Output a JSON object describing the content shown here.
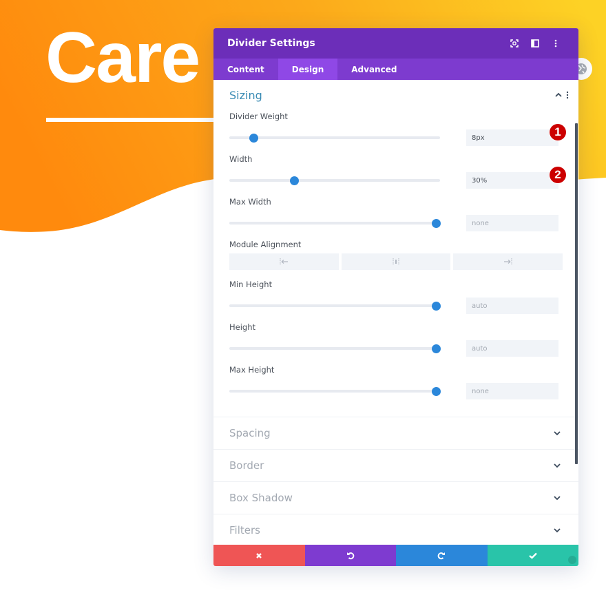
{
  "background": {
    "hero_title": "Care",
    "colors": {
      "orange": "#ff8a0d",
      "yellow": "#fdd225"
    }
  },
  "modal": {
    "title": "Divider Settings",
    "header_icons": [
      "focus-icon",
      "split-view-icon",
      "more-vertical-icon"
    ],
    "tabs": [
      {
        "label": "Content",
        "active": false
      },
      {
        "label": "Design",
        "active": true
      },
      {
        "label": "Advanced",
        "active": false
      }
    ],
    "open_section": {
      "title": "Sizing",
      "fields": [
        {
          "label": "Divider Weight",
          "value": "8px",
          "is_placeholder": false,
          "slider_fraction": 0.1,
          "badge": "1"
        },
        {
          "label": "Width",
          "value": "30%",
          "is_placeholder": false,
          "slider_fraction": 0.3,
          "badge": "2"
        },
        {
          "label": "Max Width",
          "value": "none",
          "is_placeholder": true,
          "slider_fraction": 1.0
        },
        {
          "label": "Module Alignment",
          "options": [
            "align-left",
            "align-center",
            "align-right"
          ]
        },
        {
          "label": "Min Height",
          "value": "auto",
          "is_placeholder": true,
          "slider_fraction": 1.0
        },
        {
          "label": "Height",
          "value": "auto",
          "is_placeholder": true,
          "slider_fraction": 1.0
        },
        {
          "label": "Max Height",
          "value": "none",
          "is_placeholder": true,
          "slider_fraction": 1.0
        }
      ]
    },
    "collapsed_sections": [
      "Spacing",
      "Border",
      "Box Shadow",
      "Filters"
    ],
    "footer": {
      "discard": "discard-icon",
      "undo": "undo-icon",
      "redo": "redo-icon",
      "save": "check-icon"
    },
    "colors": {
      "header": "#6c2eb9",
      "tabs": "#7d3bcf",
      "tab_active": "#8f48e6",
      "accent_blue": "#2b87da",
      "section_title": "#3a8bb4",
      "discard": "#ef5555",
      "undo": "#7e3bd0",
      "redo": "#2b87da",
      "save": "#29c4a9",
      "badge": "#cc0000"
    }
  }
}
